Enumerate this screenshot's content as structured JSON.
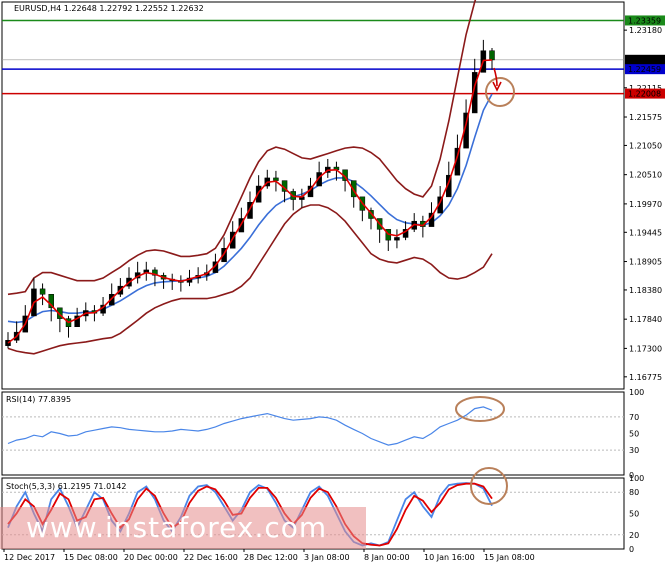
{
  "header": {
    "symbol_line": "EURUSD,H4  1.22648 1.22792 1.22552 1.22632",
    "rsi_label": "RSI(14) 77.8395",
    "stoch_label": "Stoch(5,3,3) 61.2195 71.0142"
  },
  "watermark": {
    "text": "www.instaforex.com"
  },
  "colors": {
    "price_up": "#000000",
    "candle_down": "#006400",
    "bollinger": "#8b1a1a",
    "ma_fast": "#e00000",
    "ma_slow": "#3a6fd8",
    "line_green": "#1a8a1a",
    "line_blue": "#0000cc",
    "line_red": "#cc0000",
    "rsi": "#4a86e8",
    "stoch_main": "#4a86e8",
    "stoch_signal": "#e00000",
    "circle": "#b9805a",
    "watermark_bg": "#e8a0a0"
  },
  "chart_data": {
    "type": "candlestick",
    "price_axis": {
      "ylim": [
        1.1655,
        1.237
      ],
      "ticks": [
        "1.23180",
        "1.22115",
        "1.21575",
        "1.21050",
        "1.20510",
        "1.19970",
        "1.19445",
        "1.18905",
        "1.18380",
        "1.17840",
        "1.17300",
        "1.16775"
      ]
    },
    "horizontal_levels": [
      {
        "value": 1.23359,
        "label": "1.23359",
        "color": "green"
      },
      {
        "value": 1.22632,
        "label": "1.22632",
        "color": "black"
      },
      {
        "value": 1.22459,
        "label": "1.22459",
        "color": "blue"
      },
      {
        "value": 1.22008,
        "label": "1.22008",
        "color": "red"
      }
    ],
    "x_ticks": [
      "12 Dec 2017",
      "15 Dec 08:00",
      "20 Dec 00:00",
      "22 Dec 16:00",
      "28 Dec 12:00",
      "3 Jan 08:00",
      "8 Jan 00:00",
      "10 Jan 16:00",
      "15 Jan 08:00"
    ],
    "close": [
      1.1745,
      1.176,
      1.179,
      1.184,
      1.183,
      1.1805,
      1.1785,
      1.177,
      1.179,
      1.18,
      1.1795,
      1.181,
      1.183,
      1.1845,
      1.186,
      1.187,
      1.1875,
      1.1865,
      1.1858,
      1.1855,
      1.1852,
      1.186,
      1.1865,
      1.187,
      1.189,
      1.1915,
      1.1945,
      1.197,
      1.2,
      1.203,
      1.2045,
      1.204,
      1.202,
      1.2005,
      1.201,
      1.203,
      1.2055,
      1.2065,
      1.206,
      1.204,
      1.201,
      1.1985,
      1.197,
      1.195,
      1.193,
      1.1935,
      1.195,
      1.1965,
      1.1955,
      1.198,
      1.201,
      1.205,
      1.21,
      1.2165,
      1.224,
      1.228,
      1.2263
    ],
    "high": [
      1.176,
      1.178,
      1.181,
      1.186,
      1.185,
      1.183,
      1.18,
      1.179,
      1.1805,
      1.1815,
      1.181,
      1.1825,
      1.185,
      1.186,
      1.188,
      1.189,
      1.189,
      1.188,
      1.187,
      1.1868,
      1.1865,
      1.1875,
      1.188,
      1.1885,
      1.1905,
      1.1935,
      1.1965,
      1.199,
      1.202,
      1.205,
      1.206,
      1.2058,
      1.204,
      1.2025,
      1.2025,
      1.2045,
      1.2075,
      1.208,
      1.2075,
      1.206,
      1.203,
      1.2005,
      1.199,
      1.197,
      1.195,
      1.195,
      1.1965,
      1.198,
      1.1975,
      1.2,
      1.203,
      1.2075,
      1.2125,
      1.219,
      1.2265,
      1.23,
      1.2285
    ],
    "low": [
      1.173,
      1.174,
      1.177,
      1.181,
      1.181,
      1.178,
      1.176,
      1.175,
      1.177,
      1.178,
      1.178,
      1.179,
      1.181,
      1.1825,
      1.184,
      1.185,
      1.1855,
      1.1845,
      1.184,
      1.1838,
      1.1835,
      1.1845,
      1.185,
      1.1855,
      1.187,
      1.1895,
      1.1925,
      1.195,
      1.198,
      1.201,
      1.2025,
      1.202,
      1.2,
      1.1985,
      1.199,
      1.201,
      1.2035,
      1.2045,
      1.204,
      1.202,
      1.199,
      1.1965,
      1.195,
      1.1925,
      1.191,
      1.1915,
      1.193,
      1.1945,
      1.1935,
      1.196,
      1.199,
      1.203,
      1.2075,
      1.214,
      1.2215,
      1.2255,
      1.2245
    ],
    "ma_fast": [
      1.174,
      1.1752,
      1.1775,
      1.1815,
      1.1825,
      1.181,
      1.1792,
      1.1778,
      1.1785,
      1.1795,
      1.1796,
      1.1806,
      1.1822,
      1.1838,
      1.1852,
      1.1863,
      1.187,
      1.1867,
      1.1861,
      1.1857,
      1.1854,
      1.1858,
      1.1863,
      1.1868,
      1.1883,
      1.1905,
      1.1933,
      1.196,
      1.1988,
      1.2018,
      1.2037,
      1.2039,
      1.2026,
      1.2011,
      1.201,
      1.2024,
      1.2046,
      1.2059,
      1.206,
      1.2047,
      1.2022,
      1.1998,
      1.198,
      1.196,
      1.1941,
      1.1938,
      1.1946,
      1.1959,
      1.1957,
      1.1973,
      1.2,
      1.2037,
      1.2085,
      1.2145,
      1.2215,
      1.2262,
      1.2263
    ],
    "ma_slow": [
      1.178,
      1.1778,
      1.178,
      1.179,
      1.1798,
      1.18,
      1.1798,
      1.1795,
      1.1795,
      1.1797,
      1.1798,
      1.1802,
      1.181,
      1.1818,
      1.1828,
      1.1838,
      1.1846,
      1.1851,
      1.1853,
      1.1854,
      1.1855,
      1.1857,
      1.186,
      1.1863,
      1.187,
      1.1882,
      1.1898,
      1.1915,
      1.1935,
      1.1958,
      1.1978,
      1.1994,
      1.2004,
      1.201,
      1.2015,
      1.2022,
      1.2032,
      1.204,
      1.2045,
      1.2045,
      1.2038,
      1.2026,
      1.2012,
      1.1996,
      1.198,
      1.1968,
      1.1962,
      1.196,
      1.1958,
      1.1962,
      1.1975,
      1.1995,
      1.2025,
      1.2068,
      1.212,
      1.217,
      1.22
    ],
    "bb_upper": [
      1.183,
      1.1832,
      1.1835,
      1.186,
      1.187,
      1.187,
      1.1865,
      1.186,
      1.1855,
      1.1855,
      1.1855,
      1.186,
      1.187,
      1.188,
      1.1892,
      1.1902,
      1.191,
      1.1912,
      1.191,
      1.1905,
      1.19,
      1.19,
      1.1902,
      1.1905,
      1.1915,
      1.194,
      1.1975,
      1.201,
      1.2045,
      1.2075,
      1.2095,
      1.2102,
      1.2098,
      1.209,
      1.2082,
      1.208,
      1.2085,
      1.209,
      1.2095,
      1.21,
      1.2102,
      1.21,
      1.2092,
      1.208,
      1.206,
      1.204,
      1.2025,
      1.2015,
      1.201,
      1.203,
      1.208,
      1.215,
      1.223,
      1.231,
      1.237,
      1.242,
      1.245
    ],
    "bb_lower": [
      1.173,
      1.1725,
      1.1722,
      1.172,
      1.1725,
      1.173,
      1.1735,
      1.1738,
      1.174,
      1.1742,
      1.1745,
      1.1748,
      1.175,
      1.1758,
      1.177,
      1.1782,
      1.1795,
      1.1805,
      1.1812,
      1.1818,
      1.1822,
      1.1822,
      1.1822,
      1.1822,
      1.1825,
      1.183,
      1.1835,
      1.1845,
      1.186,
      1.1885,
      1.191,
      1.1935,
      1.196,
      1.1978,
      1.199,
      1.1995,
      1.1995,
      1.199,
      1.198,
      1.1965,
      1.1945,
      1.1925,
      1.1905,
      1.1895,
      1.189,
      1.1888,
      1.1893,
      1.1898,
      1.1895,
      1.1885,
      1.187,
      1.186,
      1.1858,
      1.1862,
      1.187,
      1.188,
      1.1905
    ],
    "rsi": {
      "label": "RSI(14) 77.8395",
      "ylim": [
        0,
        100
      ],
      "ticks": [
        "100",
        "70",
        "50",
        "30",
        "0"
      ],
      "values": [
        38,
        42,
        44,
        48,
        46,
        52,
        50,
        47,
        48,
        52,
        54,
        56,
        58,
        57,
        55,
        54,
        53,
        52,
        52,
        53,
        55,
        54,
        53,
        55,
        58,
        62,
        65,
        68,
        70,
        72,
        74,
        71,
        68,
        66,
        67,
        68,
        70,
        69,
        66,
        60,
        55,
        50,
        44,
        40,
        36,
        38,
        42,
        46,
        44,
        50,
        58,
        62,
        66,
        72,
        80,
        82,
        78
      ]
    },
    "stoch": {
      "label": "Stoch(5,3,3) 61.2195 71.0142",
      "ylim": [
        0,
        100
      ],
      "ticks": [
        "100",
        "80",
        "50",
        "20",
        "0"
      ],
      "main": [
        30,
        60,
        80,
        50,
        25,
        70,
        85,
        60,
        30,
        55,
        80,
        70,
        40,
        25,
        50,
        80,
        88,
        70,
        40,
        25,
        45,
        75,
        88,
        90,
        80,
        60,
        40,
        55,
        80,
        90,
        85,
        65,
        40,
        30,
        55,
        80,
        88,
        75,
        50,
        25,
        10,
        5,
        8,
        5,
        10,
        40,
        70,
        80,
        60,
        45,
        75,
        90,
        92,
        93,
        92,
        85,
        61
      ],
      "signal": [
        35,
        50,
        70,
        60,
        35,
        55,
        78,
        70,
        40,
        45,
        70,
        72,
        50,
        30,
        42,
        70,
        85,
        75,
        50,
        30,
        38,
        65,
        82,
        88,
        84,
        68,
        48,
        50,
        72,
        86,
        86,
        72,
        50,
        35,
        48,
        72,
        85,
        80,
        60,
        35,
        18,
        8,
        6,
        5,
        8,
        28,
        55,
        75,
        68,
        52,
        65,
        84,
        90,
        92,
        92,
        88,
        71
      ]
    }
  }
}
